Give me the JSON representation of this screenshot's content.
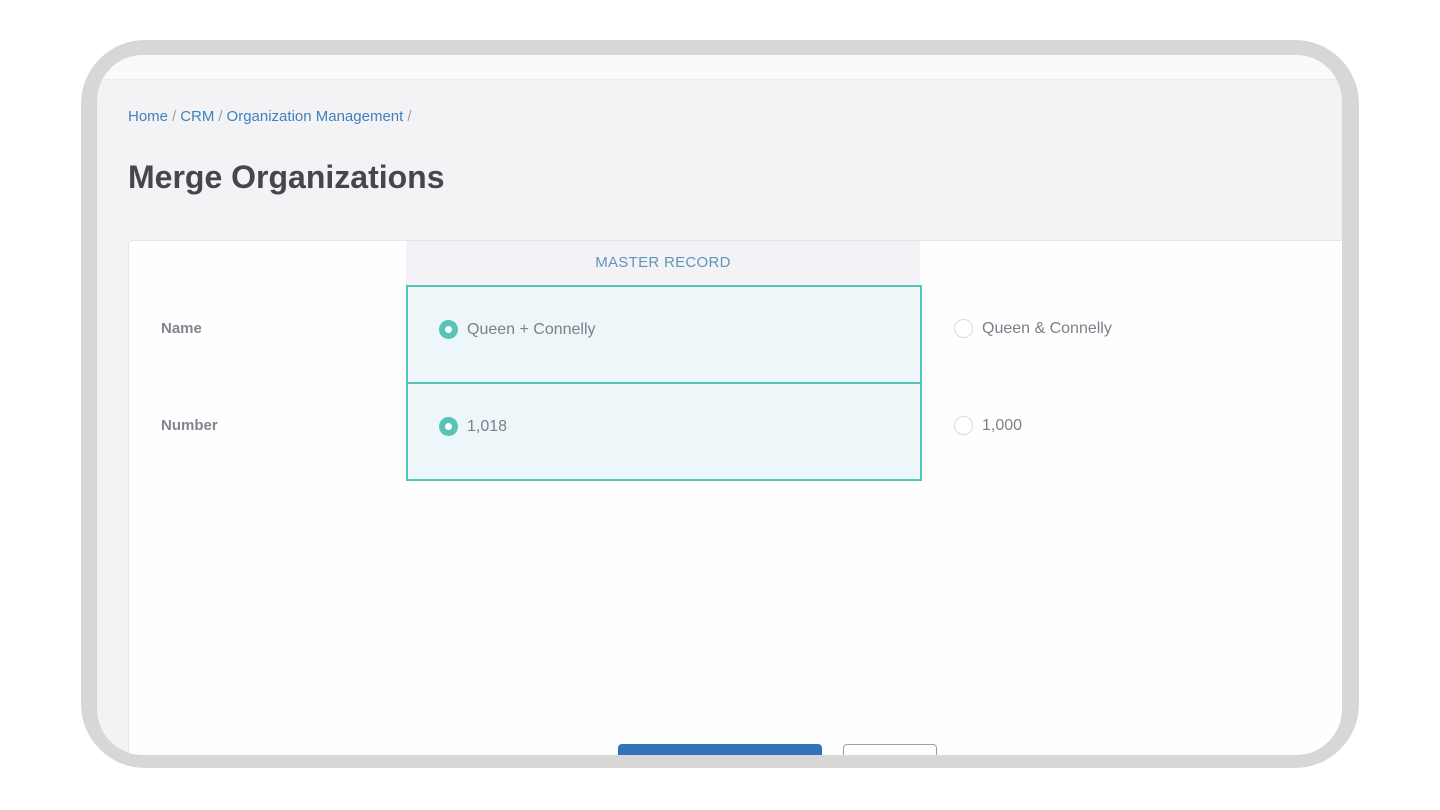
{
  "breadcrumb": {
    "items": [
      "Home",
      "CRM",
      "Organization Management"
    ],
    "separator": "/"
  },
  "page": {
    "title": "Merge Organizations"
  },
  "merge": {
    "master_header": "MASTER RECORD",
    "rows": [
      {
        "label": "Name",
        "master_value": "Queen + Connelly",
        "master_selected": true,
        "other_value": "Queen & Connelly",
        "other_selected": false
      },
      {
        "label": "Number",
        "master_value": "1,018",
        "master_selected": true,
        "other_value": "1,000",
        "other_selected": false
      }
    ]
  },
  "colors": {
    "accent": "#57c4b5",
    "link": "#3f80bf",
    "primary_button": "#3173b8"
  }
}
